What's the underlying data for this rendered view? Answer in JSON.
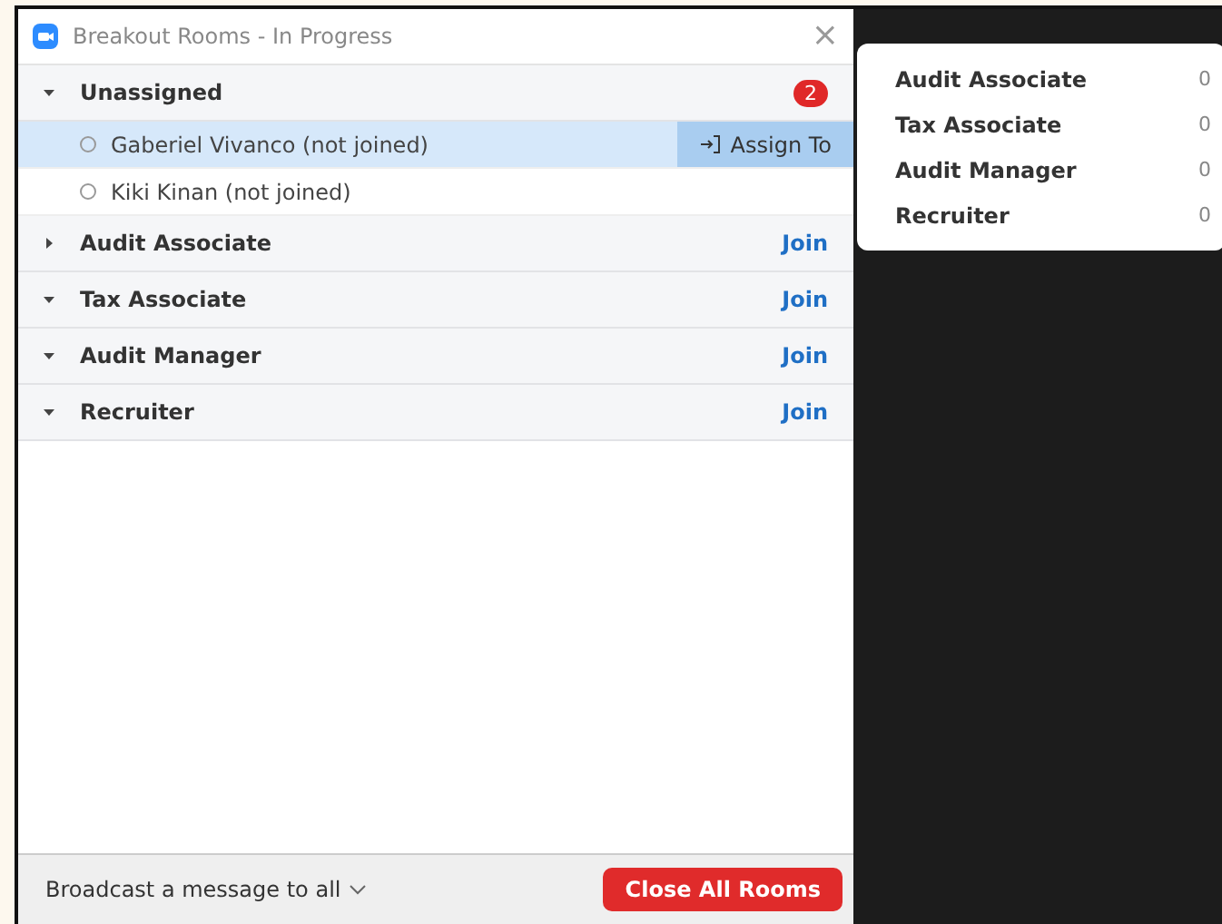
{
  "window": {
    "title": "Breakout Rooms - In Progress",
    "close": "×"
  },
  "rooms": [
    {
      "name": "Unassigned",
      "expanded": true,
      "count": "2",
      "participants": [
        {
          "name": "Gaberiel Vivanco (not joined)",
          "selected": true,
          "action": "Assign To"
        },
        {
          "name": "Kiki Kinan (not joined)",
          "selected": false
        }
      ]
    },
    {
      "name": "Audit Associate",
      "expanded": false,
      "action": "Join"
    },
    {
      "name": "Tax Associate",
      "expanded": true,
      "action": "Join"
    },
    {
      "name": "Audit Manager",
      "expanded": true,
      "action": "Join"
    },
    {
      "name": "Recruiter",
      "expanded": true,
      "action": "Join"
    }
  ],
  "footer": {
    "broadcast": "Broadcast a message to all",
    "close_button": "Close All Rooms"
  },
  "assign_menu": [
    {
      "name": "Audit Associate",
      "count": "0"
    },
    {
      "name": "Tax Associate",
      "count": "0"
    },
    {
      "name": "Audit Manager",
      "count": "0"
    },
    {
      "name": "Recruiter",
      "count": "0"
    }
  ]
}
